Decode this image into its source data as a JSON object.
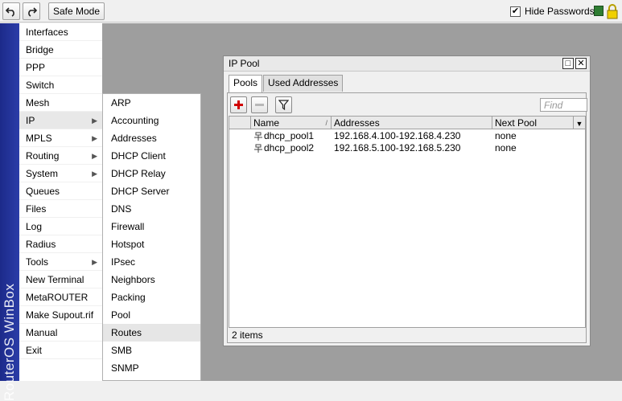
{
  "toolbar": {
    "undo_icon": "undo-icon",
    "redo_icon": "redo-icon",
    "safe_mode_label": "Safe Mode",
    "hide_passwords_label": "Hide Passwords",
    "hide_passwords_checked": true,
    "status_color": "#2e7d32"
  },
  "brand": {
    "label": "RouterOS WinBox",
    "color": "#1c2a8a"
  },
  "main_menu": {
    "items": [
      {
        "label": "Interfaces",
        "has_submenu": false
      },
      {
        "label": "Bridge",
        "has_submenu": false
      },
      {
        "label": "PPP",
        "has_submenu": false
      },
      {
        "label": "Switch",
        "has_submenu": false
      },
      {
        "label": "Mesh",
        "has_submenu": false
      },
      {
        "label": "IP",
        "has_submenu": true
      },
      {
        "label": "MPLS",
        "has_submenu": true
      },
      {
        "label": "Routing",
        "has_submenu": true
      },
      {
        "label": "System",
        "has_submenu": true
      },
      {
        "label": "Queues",
        "has_submenu": false
      },
      {
        "label": "Files",
        "has_submenu": false
      },
      {
        "label": "Log",
        "has_submenu": false
      },
      {
        "label": "Radius",
        "has_submenu": false
      },
      {
        "label": "Tools",
        "has_submenu": true
      },
      {
        "label": "New Terminal",
        "has_submenu": false
      },
      {
        "label": "MetaROUTER",
        "has_submenu": false
      },
      {
        "label": "Make Supout.rif",
        "has_submenu": false
      },
      {
        "label": "Manual",
        "has_submenu": false
      },
      {
        "label": "Exit",
        "has_submenu": false
      }
    ]
  },
  "ip_submenu": {
    "items": [
      "ARP",
      "Accounting",
      "Addresses",
      "DHCP Client",
      "DHCP Relay",
      "DHCP Server",
      "DNS",
      "Firewall",
      "Hotspot",
      "IPsec",
      "Neighbors",
      "Packing",
      "Pool",
      "Routes",
      "SMB",
      "SNMP"
    ]
  },
  "ip_pool_window": {
    "title": "IP Pool",
    "tabs": [
      "Pools",
      "Used Addresses"
    ],
    "active_tab": "Pools",
    "find_placeholder": "Find",
    "columns": [
      "Name",
      "Addresses",
      "Next Pool"
    ],
    "rows": [
      {
        "name": "dhcp_pool1",
        "addresses": "192.168.4.100-192.168.4.230",
        "next_pool": "none"
      },
      {
        "name": "dhcp_pool2",
        "addresses": "192.168.5.100-192.168.5.230",
        "next_pool": "none"
      }
    ],
    "status": "2 items"
  }
}
